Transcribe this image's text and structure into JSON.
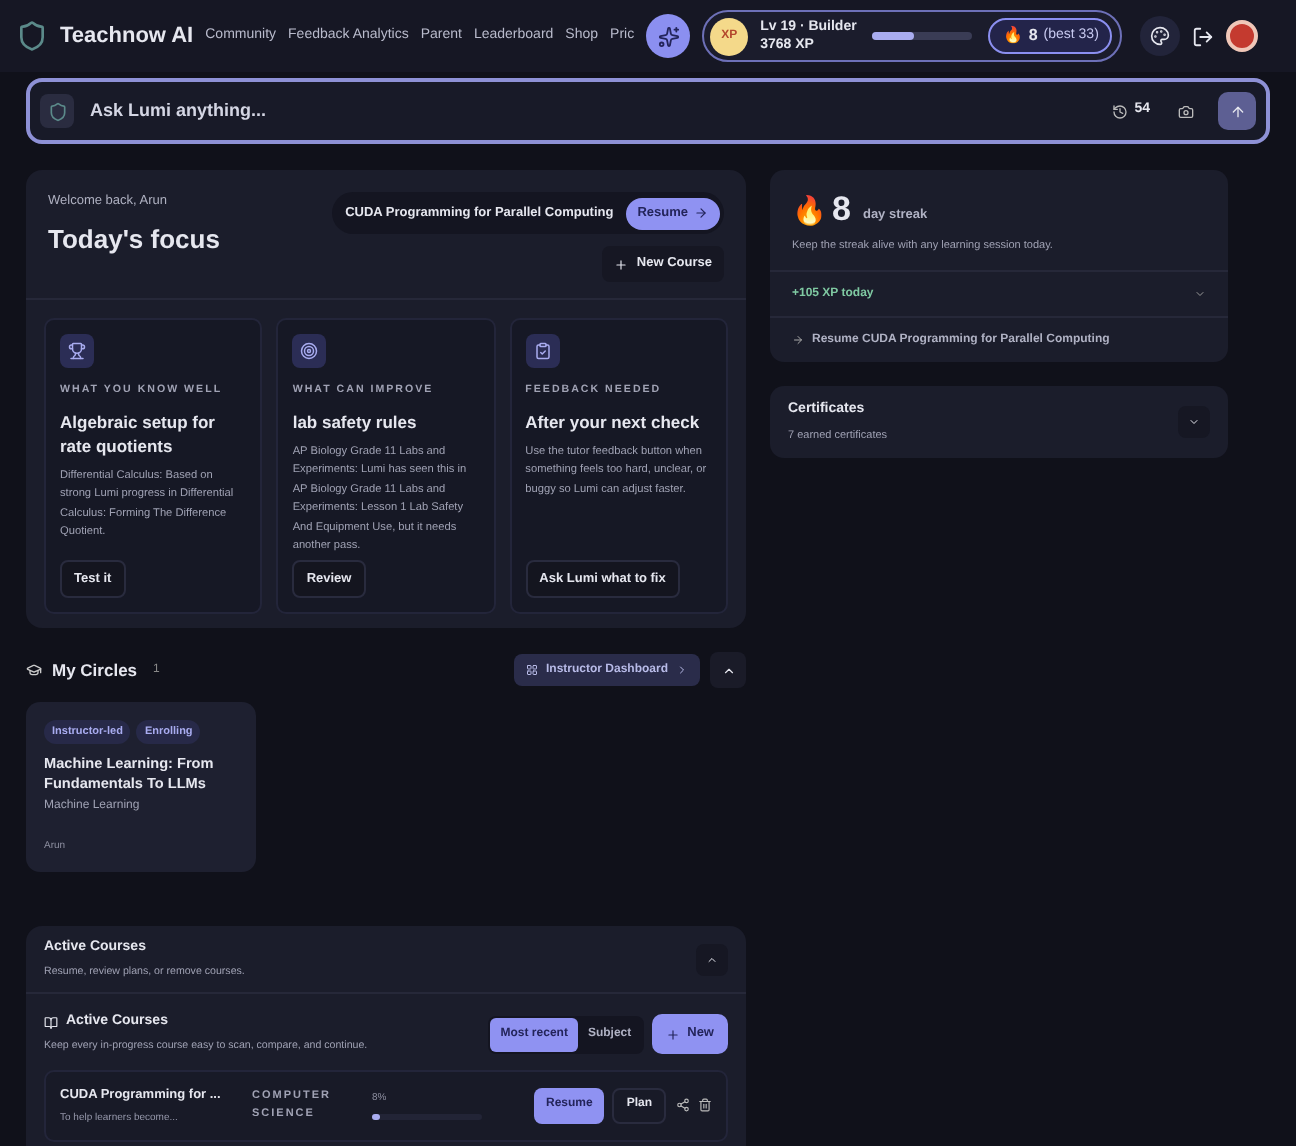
{
  "nav": {
    "brand": "Teachnow AI",
    "links": [
      {
        "label": "Community"
      },
      {
        "label": "Feedback Analytics"
      },
      {
        "label": "Parent"
      },
      {
        "label": "Leaderboard"
      },
      {
        "label": "Shop"
      },
      {
        "label": "Pric"
      }
    ],
    "xp_badge": "XP",
    "level_text": "Lv 19 · Builder",
    "xp_text": "3768 XP",
    "xp_progress": {
      "level": 0.42
    },
    "fire": "🔥",
    "streak": "8",
    "streak_best": "(best 33)"
  },
  "ask": {
    "placeholder": "Ask Lumi anything...",
    "count": "54"
  },
  "focus": {
    "welcome": "Welcome back, Arun",
    "title": "Today's focus",
    "current_course": "CUDA Programming for Parallel Computing",
    "resume": "Resume",
    "new_course": "New Course",
    "cards": [
      {
        "kind": "trophy",
        "eyebrow": "WHAT YOU KNOW WELL",
        "title": "Algebraic setup for rate quotients",
        "body": "Differential Calculus: Based on strong Lumi progress in Differential Calculus: Forming The Difference Quotient.",
        "action": "Test it"
      },
      {
        "kind": "target",
        "eyebrow": "WHAT CAN IMPROVE",
        "title": "lab safety rules",
        "body": "AP Biology Grade 11 Labs and Experiments: Lumi has seen this in AP Biology Grade 11 Labs and Experiments: Lesson 1 Lab Safety And Equipment Use, but it needs another pass.",
        "action": "Review"
      },
      {
        "kind": "clipboard",
        "eyebrow": "FEEDBACK NEEDED",
        "title": "After your next check",
        "body": "Use the tutor feedback button when something feels too hard, unclear, or buggy so Lumi can adjust faster.",
        "action": "Ask Lumi what to fix"
      }
    ]
  },
  "circles": {
    "title": "My Circles",
    "count": "1",
    "dashboard": "Instructor Dashboard",
    "expanded": true,
    "items": [
      {
        "tags": [
          "Instructor-led",
          "Enrolling"
        ],
        "title": "Machine Learning: From Fundamentals To LLMs",
        "subject": "Machine Learning",
        "owner": "Arun"
      }
    ]
  },
  "streak": {
    "fire": "🔥",
    "number": "8",
    "label": "day streak",
    "note": "Keep the streak alive with any learning session today.",
    "xp_today": "+105 XP today",
    "resume_link": "Resume CUDA Programming for Parallel Computing"
  },
  "certificates": {
    "title": "Certificates",
    "subtitle": "7 earned certificates"
  },
  "active_courses": {
    "title": "Active Courses",
    "subtitle": "Resume, review plans, or remove courses.",
    "expanded": true,
    "inner_title": "Active Courses",
    "inner_subtitle": "Keep every in-progress course easy to scan, compare, and continue.",
    "sorts": [
      {
        "label": "Most recent",
        "selected": true
      },
      {
        "label": "Subject",
        "selected": false
      }
    ],
    "new": "New",
    "rows": [
      {
        "title": "CUDA Programming for ...",
        "desc": "To help learners become...",
        "subject": "COMPUTER SCIENCE",
        "percent": "8%",
        "level": 0.08,
        "resume": "Resume",
        "plan": "Plan"
      }
    ]
  }
}
